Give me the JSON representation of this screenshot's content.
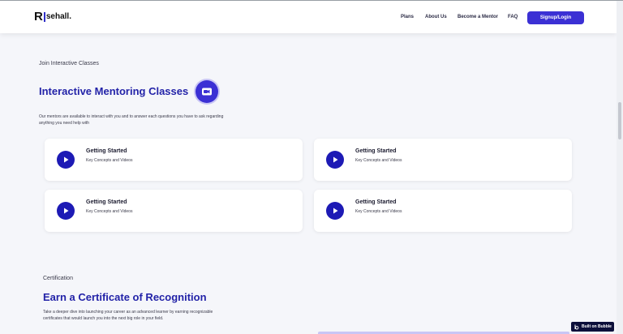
{
  "nav": {
    "logo_mark": "R",
    "logo_text": "sehall.",
    "links": [
      "Plans",
      "About Us",
      "Become a Mentor",
      "FAQ"
    ],
    "signup_label": "Signup/Login"
  },
  "classes": {
    "eyebrow": "Join Interactive Classes",
    "title": "Interactive Mentoring Classes",
    "description_line1": "Our mentors are available to interact with you and to answer each questions you have to ask regarding",
    "description_line2": "anything you need help with",
    "cards": [
      {
        "title": "Getting Started",
        "subtitle": "Key Concepts and Videos"
      },
      {
        "title": "Getting Started",
        "subtitle": "Key Concepts and Videos"
      },
      {
        "title": "Getting Started",
        "subtitle": "Key Concepts and Videos"
      },
      {
        "title": "Getting Started",
        "subtitle": "Key Concepts and Videos"
      }
    ]
  },
  "certification": {
    "eyebrow": "Certification",
    "title": "Earn a Certificate of Recognition",
    "description_line1": "Take a deeper dive into launching your career as an advanced learner by earning recognizable",
    "description_line2": "certificates that would launch you into the next big role in your field."
  },
  "badge": {
    "label": "Built on Bubble"
  },
  "colors": {
    "accent": "#3b30d4",
    "heading": "#2323a8",
    "play": "#1d1ab5"
  }
}
